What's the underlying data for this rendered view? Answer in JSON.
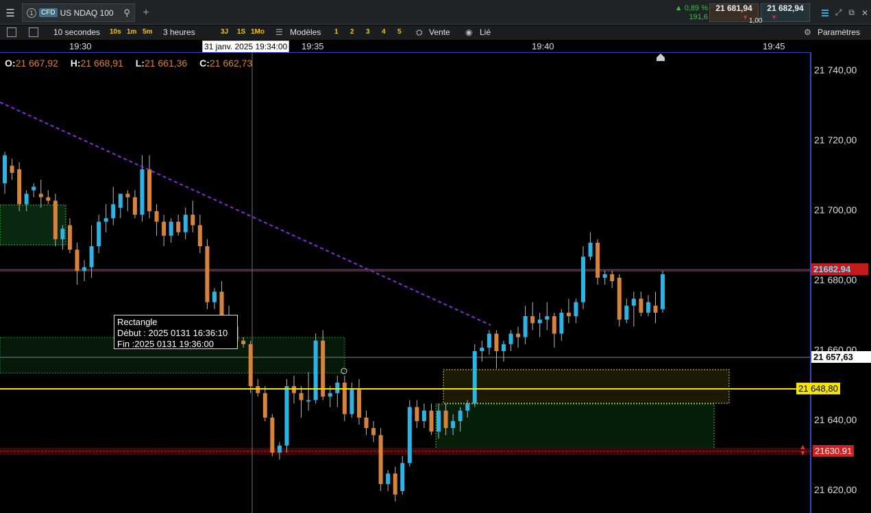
{
  "topbar": {
    "instrument_index": "1",
    "instrument_type": "CFD",
    "instrument_name": "US NDAQ 100",
    "change_pct": "0,89 %",
    "change_pts": "191,6",
    "bid": "21 681,94",
    "ask": "21 682,94",
    "spread": "1,00"
  },
  "toolbar": {
    "interval_label": "10 secondes",
    "interval_options": [
      "10s",
      "1m",
      "5m"
    ],
    "range_label": "3 heures",
    "range_options": [
      "3J",
      "1S",
      "1Mo"
    ],
    "models_label": "Modèles",
    "model_slots": [
      "1",
      "2",
      "3",
      "4",
      "5"
    ],
    "sell_label": "Vente",
    "linked_label": "Lié",
    "settings_label": "Paramètres"
  },
  "time_axis": {
    "labels": [
      "19:30",
      "19:35",
      "19:40",
      "19:45"
    ],
    "crosshair_label": "31 janv. 2025 19:34:00"
  },
  "ohlc": {
    "o_label": "O:",
    "o": "21 667,92",
    "h_label": "H:",
    "h": "21 668,91",
    "l_label": "L:",
    "l": "21 661,36",
    "c_label": "C:",
    "c": "21 662,73"
  },
  "price_axis": {
    "labels": [
      "21 740,00",
      "21 720,00",
      "21 700,00",
      "21 680,00",
      "21 660,00",
      "21 640,00",
      "21 620,00"
    ],
    "last_price_tag": "21682.94",
    "crosshair_price_tag": "21 657,63",
    "horizontal_line_tag": "21 648,80",
    "alert_tag": "21630.91"
  },
  "tooltip": {
    "title": "Rectangle",
    "start": "Début : 2025 0131 16:36:10",
    "end": "Fin :2025 0131 19:36:00"
  },
  "colors": {
    "bull": "#2bb5e6",
    "bear": "#d9823a",
    "trendline": "#8a2be2",
    "hline": "#f5e400",
    "alert": "#d21f1f",
    "zone_green": "#2ecc40",
    "zone_yellow": "#e5d63a"
  },
  "chart_data": {
    "type": "candlestick",
    "candles": [
      {
        "o": 21708,
        "h": 21717,
        "l": 21705,
        "c": 21716
      },
      {
        "o": 21713,
        "h": 21715,
        "l": 21709,
        "c": 21711
      },
      {
        "o": 21712,
        "h": 21714,
        "l": 21700,
        "c": 21702
      },
      {
        "o": 21702,
        "h": 21706,
        "l": 21700,
        "c": 21705
      },
      {
        "o": 21706,
        "h": 21708,
        "l": 21704,
        "c": 21707
      },
      {
        "o": 21705,
        "h": 21709,
        "l": 21701,
        "c": 21704
      },
      {
        "o": 21704,
        "h": 21706,
        "l": 21702,
        "c": 21703
      },
      {
        "o": 21703,
        "h": 21705,
        "l": 21690,
        "c": 21692
      },
      {
        "o": 21692,
        "h": 21696,
        "l": 21689,
        "c": 21695
      },
      {
        "o": 21696,
        "h": 21698,
        "l": 21688,
        "c": 21689
      },
      {
        "o": 21689,
        "h": 21691,
        "l": 21679,
        "c": 21683
      },
      {
        "o": 21683,
        "h": 21686,
        "l": 21680,
        "c": 21684
      },
      {
        "o": 21684,
        "h": 21696,
        "l": 21681,
        "c": 21690
      },
      {
        "o": 21690,
        "h": 21699,
        "l": 21688,
        "c": 21697
      },
      {
        "o": 21697,
        "h": 21702,
        "l": 21694,
        "c": 21698
      },
      {
        "o": 21698,
        "h": 21707,
        "l": 21696,
        "c": 21702
      },
      {
        "o": 21701,
        "h": 21705,
        "l": 21698,
        "c": 21705
      },
      {
        "o": 21705,
        "h": 21706,
        "l": 21700,
        "c": 21704
      },
      {
        "o": 21704,
        "h": 21706,
        "l": 21698,
        "c": 21699
      },
      {
        "o": 21699,
        "h": 21716,
        "l": 21697,
        "c": 21712
      },
      {
        "o": 21712,
        "h": 21716,
        "l": 21698,
        "c": 21700
      },
      {
        "o": 21700,
        "h": 21702,
        "l": 21693,
        "c": 21697
      },
      {
        "o": 21697,
        "h": 21699,
        "l": 21690,
        "c": 21693
      },
      {
        "o": 21693,
        "h": 21698,
        "l": 21691,
        "c": 21697
      },
      {
        "o": 21697,
        "h": 21699,
        "l": 21693,
        "c": 21694
      },
      {
        "o": 21694,
        "h": 21701,
        "l": 21692,
        "c": 21699
      },
      {
        "o": 21699,
        "h": 21703,
        "l": 21694,
        "c": 21696
      },
      {
        "o": 21696,
        "h": 21699,
        "l": 21688,
        "c": 21690
      },
      {
        "o": 21690,
        "h": 21692,
        "l": 21672,
        "c": 21674
      },
      {
        "o": 21674,
        "h": 21678,
        "l": 21672,
        "c": 21677
      },
      {
        "o": 21677,
        "h": 21680,
        "l": 21668,
        "c": 21670
      },
      {
        "o": 21670,
        "h": 21673,
        "l": 21666,
        "c": 21667
      },
      {
        "o": 21667,
        "h": 21668,
        "l": 21661,
        "c": 21663
      },
      {
        "o": 21663,
        "h": 21664,
        "l": 21661,
        "c": 21662
      },
      {
        "o": 21662,
        "h": 21663,
        "l": 21648,
        "c": 21650
      },
      {
        "o": 21650,
        "h": 21652,
        "l": 21647,
        "c": 21648
      },
      {
        "o": 21648,
        "h": 21650,
        "l": 21640,
        "c": 21641
      },
      {
        "o": 21641,
        "h": 21642,
        "l": 21630,
        "c": 21631
      },
      {
        "o": 21631,
        "h": 21634,
        "l": 21629,
        "c": 21633
      },
      {
        "o": 21633,
        "h": 21652,
        "l": 21631,
        "c": 21650
      },
      {
        "o": 21650,
        "h": 21653,
        "l": 21645,
        "c": 21648
      },
      {
        "o": 21648,
        "h": 21650,
        "l": 21641,
        "c": 21646
      },
      {
        "o": 21646,
        "h": 21654,
        "l": 21643,
        "c": 21646
      },
      {
        "o": 21646,
        "h": 21665,
        "l": 21645,
        "c": 21663
      },
      {
        "o": 21663,
        "h": 21666,
        "l": 21646,
        "c": 21647
      },
      {
        "o": 21647,
        "h": 21650,
        "l": 21644,
        "c": 21648
      },
      {
        "o": 21648,
        "h": 21653,
        "l": 21644,
        "c": 21651
      },
      {
        "o": 21651,
        "h": 21653,
        "l": 21640,
        "c": 21642
      },
      {
        "o": 21642,
        "h": 21651,
        "l": 21641,
        "c": 21649
      },
      {
        "o": 21649,
        "h": 21652,
        "l": 21639,
        "c": 21641
      },
      {
        "o": 21641,
        "h": 21643,
        "l": 21636,
        "c": 21638
      },
      {
        "o": 21638,
        "h": 21640,
        "l": 21634,
        "c": 21636
      },
      {
        "o": 21636,
        "h": 21638,
        "l": 21620,
        "c": 21622
      },
      {
        "o": 21622,
        "h": 21626,
        "l": 21620,
        "c": 21625
      },
      {
        "o": 21625,
        "h": 21627,
        "l": 21617,
        "c": 21619
      },
      {
        "o": 21620,
        "h": 21630,
        "l": 21619,
        "c": 21628
      },
      {
        "o": 21628,
        "h": 21646,
        "l": 21627,
        "c": 21644
      },
      {
        "o": 21644,
        "h": 21646,
        "l": 21638,
        "c": 21640
      },
      {
        "o": 21640,
        "h": 21645,
        "l": 21638,
        "c": 21643
      },
      {
        "o": 21643,
        "h": 21645,
        "l": 21636,
        "c": 21637
      },
      {
        "o": 21637,
        "h": 21645,
        "l": 21635,
        "c": 21643
      },
      {
        "o": 21643,
        "h": 21645,
        "l": 21636,
        "c": 21638
      },
      {
        "o": 21638,
        "h": 21642,
        "l": 21636,
        "c": 21640
      },
      {
        "o": 21640,
        "h": 21644,
        "l": 21637,
        "c": 21643
      },
      {
        "o": 21643,
        "h": 21646,
        "l": 21641,
        "c": 21645
      },
      {
        "o": 21645,
        "h": 21662,
        "l": 21644,
        "c": 21660
      },
      {
        "o": 21660,
        "h": 21663,
        "l": 21657,
        "c": 21661
      },
      {
        "o": 21661,
        "h": 21666,
        "l": 21659,
        "c": 21665
      },
      {
        "o": 21665,
        "h": 21666,
        "l": 21655,
        "c": 21660
      },
      {
        "o": 21660,
        "h": 21663,
        "l": 21657,
        "c": 21662
      },
      {
        "o": 21662,
        "h": 21666,
        "l": 21660,
        "c": 21665
      },
      {
        "o": 21665,
        "h": 21667,
        "l": 21661,
        "c": 21664
      },
      {
        "o": 21664,
        "h": 21673,
        "l": 21662,
        "c": 21670
      },
      {
        "o": 21670,
        "h": 21674,
        "l": 21666,
        "c": 21668
      },
      {
        "o": 21668,
        "h": 21671,
        "l": 21664,
        "c": 21669
      },
      {
        "o": 21669,
        "h": 21674,
        "l": 21666,
        "c": 21670
      },
      {
        "o": 21670,
        "h": 21671,
        "l": 21661,
        "c": 21665
      },
      {
        "o": 21665,
        "h": 21672,
        "l": 21663,
        "c": 21671
      },
      {
        "o": 21671,
        "h": 21675,
        "l": 21668,
        "c": 21670
      },
      {
        "o": 21670,
        "h": 21675,
        "l": 21668,
        "c": 21674
      },
      {
        "o": 21674,
        "h": 21690,
        "l": 21672,
        "c": 21687
      },
      {
        "o": 21687,
        "h": 21694,
        "l": 21686,
        "c": 21691
      },
      {
        "o": 21691,
        "h": 21692,
        "l": 21679,
        "c": 21681
      },
      {
        "o": 21681,
        "h": 21683,
        "l": 21679,
        "c": 21682
      },
      {
        "o": 21682,
        "h": 21683,
        "l": 21678,
        "c": 21680
      },
      {
        "o": 21681,
        "h": 21682,
        "l": 21667,
        "c": 21669
      },
      {
        "o": 21669,
        "h": 21675,
        "l": 21668,
        "c": 21673
      },
      {
        "o": 21673,
        "h": 21677,
        "l": 21667,
        "c": 21675
      },
      {
        "o": 21675,
        "h": 21677,
        "l": 21670,
        "c": 21671
      },
      {
        "o": 21671,
        "h": 21676,
        "l": 21670,
        "c": 21674
      },
      {
        "o": 21673,
        "h": 21677,
        "l": 21668,
        "c": 21671
      },
      {
        "o": 21672,
        "h": 21683,
        "l": 21671,
        "c": 21682
      }
    ]
  }
}
